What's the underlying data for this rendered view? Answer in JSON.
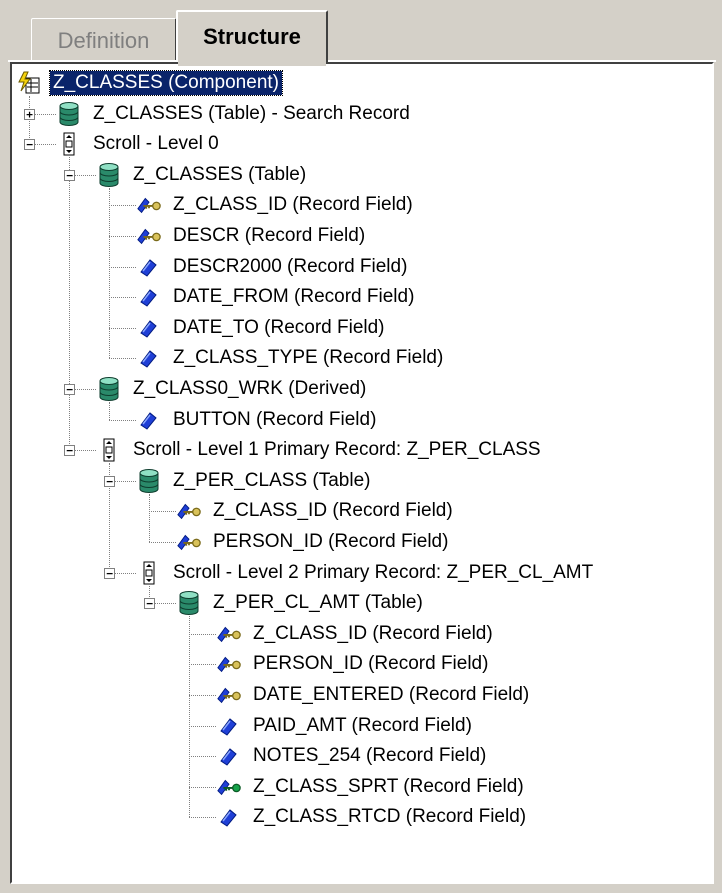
{
  "tabs": [
    {
      "label": "Definition",
      "active": false
    },
    {
      "label": "Structure",
      "active": true
    }
  ],
  "tree": [
    {
      "label": "Z_CLASSES (Component)",
      "icon": "component-icon",
      "level": 0,
      "selected": true
    },
    {
      "label": "Z_CLASSES (Table) - Search Record",
      "icon": "table-icon",
      "level": 1,
      "expander": "+"
    },
    {
      "label": "Scroll - Level 0",
      "icon": "scroll-icon",
      "level": 1,
      "expander": "-"
    },
    {
      "label": "Z_CLASSES (Table)",
      "icon": "table-icon",
      "level": 2,
      "expander": "-"
    },
    {
      "label": "Z_CLASS_ID (Record Field)",
      "icon": "key-field-icon",
      "level": 3
    },
    {
      "label": "DESCR (Record Field)",
      "icon": "key-field-icon",
      "level": 3
    },
    {
      "label": "DESCR2000 (Record Field)",
      "icon": "field-icon",
      "level": 3
    },
    {
      "label": "DATE_FROM (Record Field)",
      "icon": "field-icon",
      "level": 3
    },
    {
      "label": "DATE_TO (Record Field)",
      "icon": "field-icon",
      "level": 3
    },
    {
      "label": "Z_CLASS_TYPE (Record Field)",
      "icon": "field-icon",
      "level": 3
    },
    {
      "label": "Z_CLASS0_WRK (Derived)",
      "icon": "table-icon",
      "level": 2,
      "expander": "-"
    },
    {
      "label": "BUTTON (Record Field)",
      "icon": "field-icon",
      "level": 3
    },
    {
      "label": "Scroll - Level 1  Primary Record: Z_PER_CLASS",
      "icon": "scroll-icon",
      "level": 2,
      "expander": "-"
    },
    {
      "label": "Z_PER_CLASS (Table)",
      "icon": "table-icon",
      "level": 3,
      "expander": "-"
    },
    {
      "label": "Z_CLASS_ID (Record Field)",
      "icon": "key-field-icon",
      "level": 4
    },
    {
      "label": "PERSON_ID (Record Field)",
      "icon": "key-field-icon",
      "level": 4
    },
    {
      "label": "Scroll - Level 2  Primary Record: Z_PER_CL_AMT",
      "icon": "scroll-icon",
      "level": 3,
      "expander": "-"
    },
    {
      "label": "Z_PER_CL_AMT (Table)",
      "icon": "table-icon",
      "level": 4,
      "expander": "-"
    },
    {
      "label": "Z_CLASS_ID (Record Field)",
      "icon": "key-field-icon",
      "level": 5
    },
    {
      "label": "PERSON_ID (Record Field)",
      "icon": "key-field-icon",
      "level": 5
    },
    {
      "label": "DATE_ENTERED (Record Field)",
      "icon": "key-field-icon",
      "level": 5
    },
    {
      "label": "PAID_AMT (Record Field)",
      "icon": "field-icon",
      "level": 5
    },
    {
      "label": "NOTES_254 (Record Field)",
      "icon": "field-icon",
      "level": 5
    },
    {
      "label": "Z_CLASS_SPRT (Record Field)",
      "icon": "search-key-field-icon",
      "level": 5
    },
    {
      "label": "Z_CLASS_RTCD (Record Field)",
      "icon": "field-icon",
      "level": 5
    }
  ],
  "colors": {
    "selection": "#0a246a",
    "key": "#7a6a1a",
    "field": "#1f3fd6",
    "table": "#2a8a6a",
    "search_key": "#16a34a"
  }
}
